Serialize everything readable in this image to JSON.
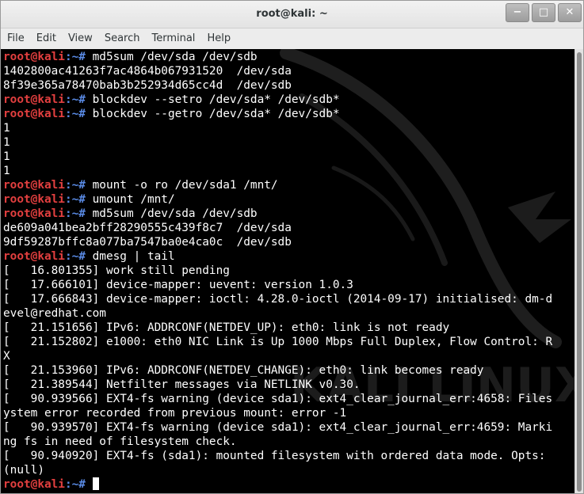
{
  "window": {
    "title": "root@kali: ~",
    "controls": {
      "minimize": "−",
      "maximize": "□",
      "close": "✕"
    }
  },
  "menu": [
    "File",
    "Edit",
    "View",
    "Search",
    "Terminal",
    "Help"
  ],
  "prompt": {
    "user_host": "root@kali",
    "sep": ":~# "
  },
  "watermark": "KALI LINUX",
  "terminal_lines": [
    {
      "type": "cmd",
      "text": "md5sum /dev/sda /dev/sdb"
    },
    {
      "type": "out",
      "text": "1402800ac41263f7ac4864b067931520  /dev/sda"
    },
    {
      "type": "out",
      "text": "8f39e365a78470bab3b252934d65cc4d  /dev/sdb"
    },
    {
      "type": "cmd",
      "text": "blockdev --setro /dev/sda* /dev/sdb*"
    },
    {
      "type": "cmd",
      "text": "blockdev --getro /dev/sda* /dev/sdb*"
    },
    {
      "type": "out",
      "text": "1"
    },
    {
      "type": "out",
      "text": "1"
    },
    {
      "type": "out",
      "text": "1"
    },
    {
      "type": "out",
      "text": "1"
    },
    {
      "type": "cmd",
      "text": "mount -o ro /dev/sda1 /mnt/"
    },
    {
      "type": "cmd",
      "text": "umount /mnt/"
    },
    {
      "type": "cmd",
      "text": "md5sum /dev/sda /dev/sdb"
    },
    {
      "type": "out",
      "text": "de609a041bea2bff28290555c439f8c7  /dev/sda"
    },
    {
      "type": "out",
      "text": "9df59287bffc8a077ba7547ba0e4ca0c  /dev/sdb"
    },
    {
      "type": "cmd",
      "text": "dmesg | tail"
    },
    {
      "type": "out",
      "text": "[   16.801355] work still pending"
    },
    {
      "type": "out",
      "text": "[   17.666101] device-mapper: uevent: version 1.0.3"
    },
    {
      "type": "out",
      "text": "[   17.666843] device-mapper: ioctl: 4.28.0-ioctl (2014-09-17) initialised: dm-d"
    },
    {
      "type": "out",
      "text": "evel@redhat.com"
    },
    {
      "type": "out",
      "text": "[   21.151656] IPv6: ADDRCONF(NETDEV_UP): eth0: link is not ready"
    },
    {
      "type": "out",
      "text": "[   21.152802] e1000: eth0 NIC Link is Up 1000 Mbps Full Duplex, Flow Control: R"
    },
    {
      "type": "out",
      "text": "X"
    },
    {
      "type": "out",
      "text": "[   21.153960] IPv6: ADDRCONF(NETDEV_CHANGE): eth0: link becomes ready"
    },
    {
      "type": "out",
      "text": "[   21.389544] Netfilter messages via NETLINK v0.30."
    },
    {
      "type": "out",
      "text": "[   90.939566] EXT4-fs warning (device sda1): ext4_clear_journal_err:4658: Files"
    },
    {
      "type": "out",
      "text": "ystem error recorded from previous mount: error -1"
    },
    {
      "type": "out",
      "text": "[   90.939570] EXT4-fs warning (device sda1): ext4_clear_journal_err:4659: Marki"
    },
    {
      "type": "out",
      "text": "ng fs in need of filesystem check."
    },
    {
      "type": "out",
      "text": "[   90.940920] EXT4-fs (sda1): mounted filesystem with ordered data mode. Opts:"
    },
    {
      "type": "out",
      "text": "(null)"
    },
    {
      "type": "cmd",
      "text": "",
      "cursor": true
    }
  ],
  "colors": {
    "user_host": "#e23f3f",
    "path_prompt": "#5a8be6",
    "output": "#ffffff",
    "background": "#000000"
  }
}
